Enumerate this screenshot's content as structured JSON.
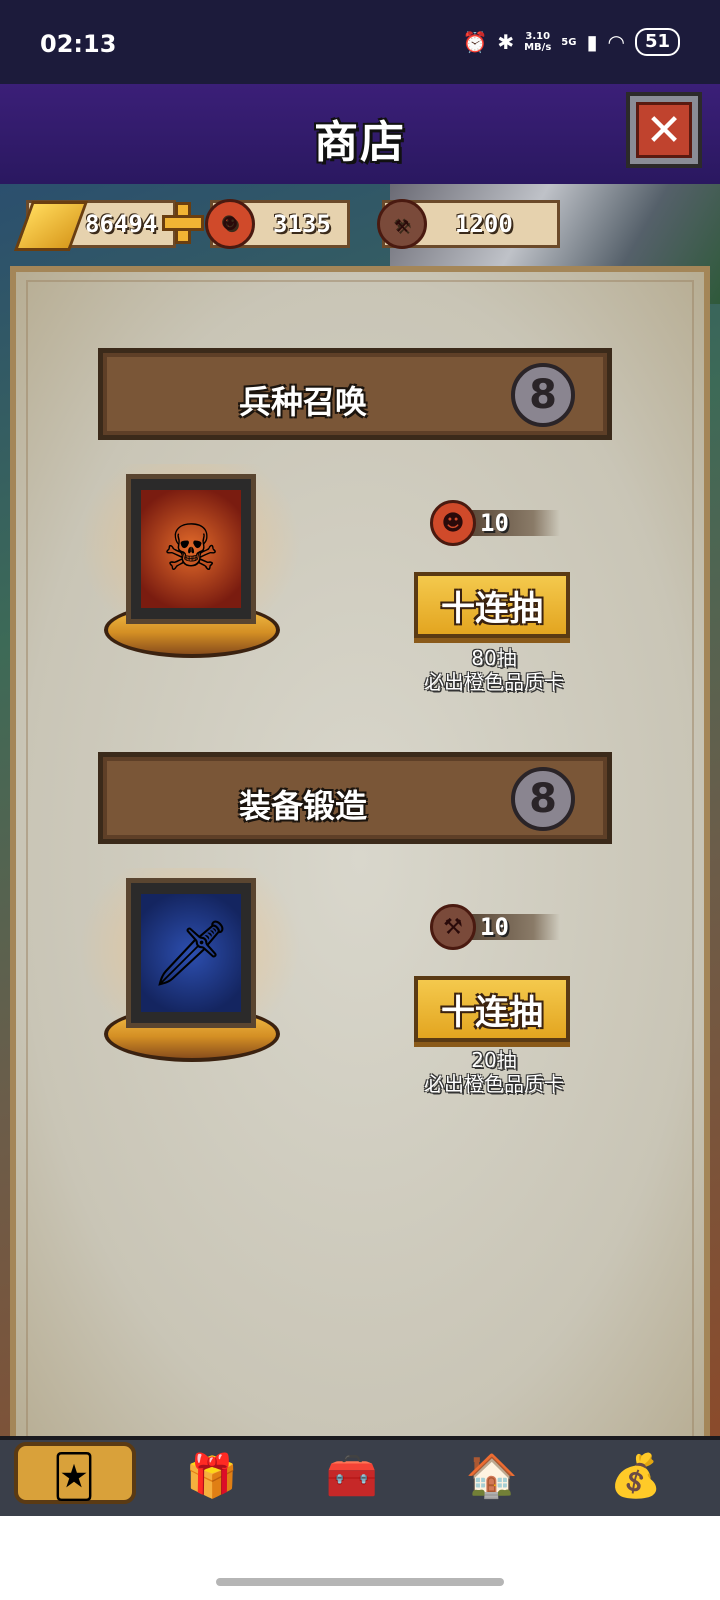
{
  "status_bar": {
    "time": "02:13",
    "net_speed_top": "3.10",
    "net_speed_bottom": "MB/s",
    "network": "5G",
    "battery": "51"
  },
  "header": {
    "title": "商店"
  },
  "currencies": {
    "gold": "86494",
    "demon_tokens": "3135",
    "anvil_tokens": "1200"
  },
  "sections": [
    {
      "title": "兵种召唤",
      "cost": "10",
      "button_label": "十连抽",
      "note_line1": "80抽",
      "note_line2": "必出橙色品质卡"
    },
    {
      "title": "装备锻造",
      "cost": "10",
      "button_label": "十连抽",
      "note_line1": "20抽",
      "note_line2": "必出橙色品质卡"
    }
  ],
  "bottom_nav": [
    "card-icon",
    "gift-icon",
    "treasure-chest-icon",
    "tavern-icon",
    "vip-money-bag-icon"
  ]
}
